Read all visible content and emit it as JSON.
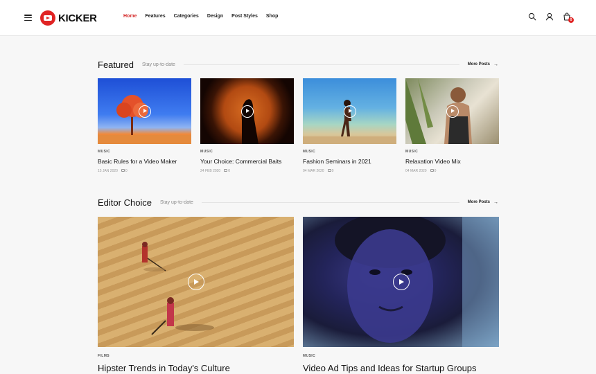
{
  "header": {
    "logo_text": "KICKER",
    "nav": [
      {
        "label": "Home",
        "active": true
      },
      {
        "label": "Features"
      },
      {
        "label": "Categories"
      },
      {
        "label": "Design"
      },
      {
        "label": "Post Styles"
      },
      {
        "label": "Shop"
      }
    ],
    "cart_count": "0",
    "accent_color": "#e02424"
  },
  "featured": {
    "title": "Featured",
    "subtitle": "Stay up-to-date",
    "more": "More Posts",
    "posts": [
      {
        "category": "MUSIC",
        "title": "Basic Rules for a Video Maker",
        "date": "15 JAN 2020",
        "comments": "0"
      },
      {
        "category": "MUSIC",
        "title": "Your Choice: Commercial Baits",
        "date": "24 FEB 2020",
        "comments": "0"
      },
      {
        "category": "MUSIC",
        "title": "Fashion Seminars in 2021",
        "date": "04 MAR 2020",
        "comments": "0"
      },
      {
        "category": "MUSIC",
        "title": "Relaxation Video Mix",
        "date": "04 MAR 2020",
        "comments": "0"
      }
    ]
  },
  "editor": {
    "title": "Editor Choice",
    "subtitle": "Stay up-to-date",
    "more": "More Posts",
    "posts": [
      {
        "category": "FILMS",
        "title": "Hipster Trends in Today's Culture"
      },
      {
        "category": "MUSIC",
        "title": "Video Ad Tips and Ideas for Startup Groups"
      }
    ]
  }
}
